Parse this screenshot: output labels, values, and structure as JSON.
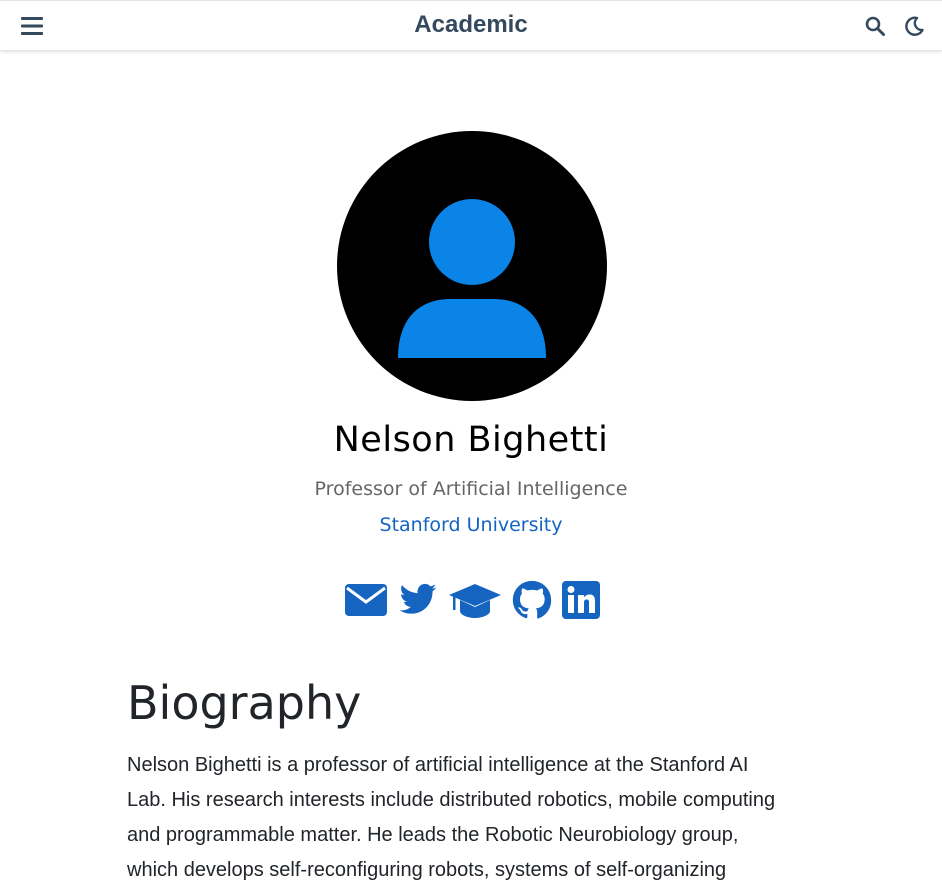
{
  "navbar": {
    "brand": "Academic",
    "menu_icon": "hamburger-icon",
    "search_icon": "search-icon",
    "theme_icon": "moon-icon"
  },
  "profile": {
    "name": "Nelson Bighetti",
    "role": "Professor of Artificial Intelligence",
    "organization": "Stanford University",
    "avatar_icon": "user-avatar-icon",
    "social": [
      "envelope-icon",
      "twitter-icon",
      "graduation-cap-icon",
      "github-icon",
      "linkedin-icon"
    ]
  },
  "biography": {
    "title": "Biography",
    "lines": [
      "Nelson Bighetti is a professor of artificial intelligence at the Stanford AI",
      "Lab. His research interests include distributed robotics, mobile computing",
      "and programmable matter. He leads the Robotic Neurobiology group,",
      "which develops self-reconfiguring robots, systems of self-organizing"
    ]
  },
  "colors": {
    "accent": "#1565c0",
    "avatar_bg": "#000000",
    "avatar_fg": "#0a84e6",
    "brand": "#34495e"
  }
}
